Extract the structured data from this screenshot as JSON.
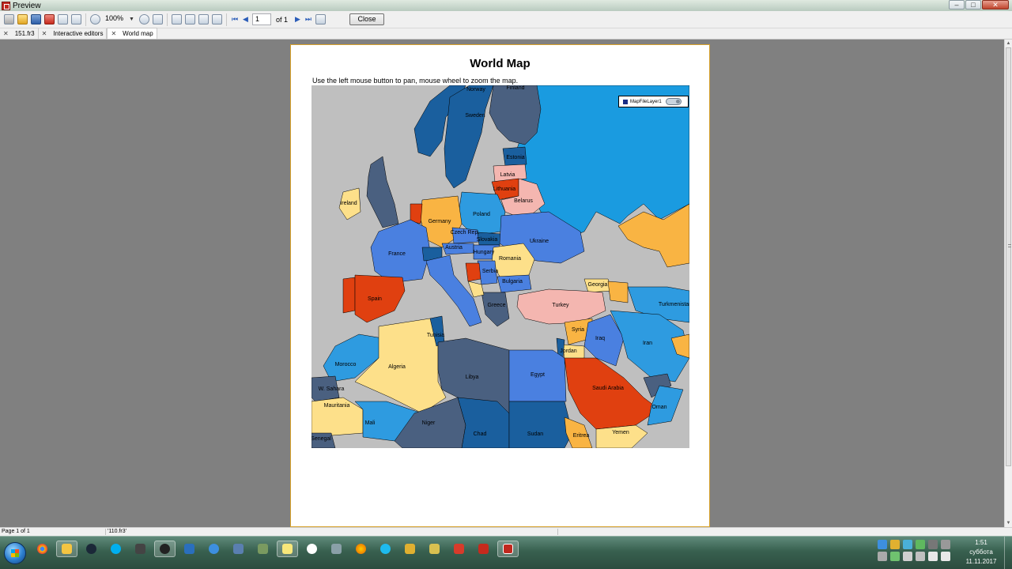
{
  "window": {
    "title": "Preview",
    "controls": {
      "minimize": "–",
      "maximize": "□",
      "close": "✕"
    }
  },
  "toolbar": {
    "icons": [
      "print-icon",
      "open-icon",
      "save-icon",
      "pdf-icon",
      "email-icon",
      "find-icon",
      "zoom-in-icon",
      "zoom-out-icon",
      "fit-page-icon",
      "page-width-icon",
      "whole-page-icon",
      "edit-page-icon",
      "watermark-icon",
      "outline-icon"
    ],
    "zoom_value": "100%",
    "page_value": "1",
    "page_of": "of 1",
    "close_label": "Close"
  },
  "tabs": [
    {
      "label": "151.fr3",
      "active": false
    },
    {
      "label": "Interactive editors",
      "active": false
    },
    {
      "label": "World map",
      "active": true
    }
  ],
  "report": {
    "title": "World Map",
    "hint": "Use the left mouse button to pan, mouse wheel to zoom the map.",
    "legend_label": "MapFileLayer1"
  },
  "map": {
    "countries": [
      {
        "name": "Norway",
        "color": "#1a5f9e"
      },
      {
        "name": "Sweden",
        "color": "#1a5f9e"
      },
      {
        "name": "Finland",
        "color": "#4a6080"
      },
      {
        "name": "Estonia",
        "color": "#1a5f9e"
      },
      {
        "name": "Latvia",
        "color": "#f4b6b0"
      },
      {
        "name": "Lithuania",
        "color": "#e04010"
      },
      {
        "name": "Belarus",
        "color": "#f4b6b0"
      },
      {
        "name": "Ireland",
        "color": "#fde08a"
      },
      {
        "name": "Poland",
        "color": "#2e9be0"
      },
      {
        "name": "Germany",
        "color": "#f9b443"
      },
      {
        "name": "Czech Rep.",
        "color": "#4a80e0"
      },
      {
        "name": "Slovakia",
        "color": "#1a5f9e"
      },
      {
        "name": "Austria",
        "color": "#4a80e0"
      },
      {
        "name": "Hungary",
        "color": "#4a80e0"
      },
      {
        "name": "Ukraine",
        "color": "#4a80e0"
      },
      {
        "name": "France",
        "color": "#4a80e0"
      },
      {
        "name": "Romania",
        "color": "#fde08a"
      },
      {
        "name": "Serbia",
        "color": "#4a80e0"
      },
      {
        "name": "Bulgaria",
        "color": "#4a80e0"
      },
      {
        "name": "Georgia",
        "color": "#fde08a"
      },
      {
        "name": "Spain",
        "color": "#e04010"
      },
      {
        "name": "Turkey",
        "color": "#f4b6b0"
      },
      {
        "name": "Turkmenistan",
        "color": "#2e9be0"
      },
      {
        "name": "Syria",
        "color": "#f9b443"
      },
      {
        "name": "Iraq",
        "color": "#4a80e0"
      },
      {
        "name": "Iran",
        "color": "#2e9be0"
      },
      {
        "name": "Jordan",
        "color": "#fde08a"
      },
      {
        "name": "Morocco",
        "color": "#2e9be0"
      },
      {
        "name": "Algeria",
        "color": "#fde08a"
      },
      {
        "name": "Tunisia",
        "color": "#1a5f9e"
      },
      {
        "name": "Libya",
        "color": "#4a6080"
      },
      {
        "name": "Egypt",
        "color": "#4a80e0"
      },
      {
        "name": "Saudi Arabia",
        "color": "#e04010"
      },
      {
        "name": "Oman",
        "color": "#2e9be0"
      },
      {
        "name": "W. Sahara",
        "color": "#4a6080"
      },
      {
        "name": "Mauritania",
        "color": "#fde08a"
      },
      {
        "name": "Mali",
        "color": "#2e9be0"
      },
      {
        "name": "Niger",
        "color": "#4a6080"
      },
      {
        "name": "Chad",
        "color": "#1a5f9e"
      },
      {
        "name": "Sudan",
        "color": "#1a5f9e"
      },
      {
        "name": "Eritrea",
        "color": "#f9b443"
      },
      {
        "name": "Yemen",
        "color": "#fde08a"
      },
      {
        "name": "Senegal",
        "color": "#4a6080"
      },
      {
        "name": "Greece",
        "color": "#4a6080"
      }
    ],
    "ocean_color": "#bfbfbf",
    "russia_color": "#1a9be0"
  },
  "status": {
    "page": "Page 1 of 1",
    "file": "'110.fr3'"
  },
  "taskbar": {
    "clock_time": "1:51",
    "clock_day": "суббота",
    "clock_date": "11.11.2017"
  }
}
